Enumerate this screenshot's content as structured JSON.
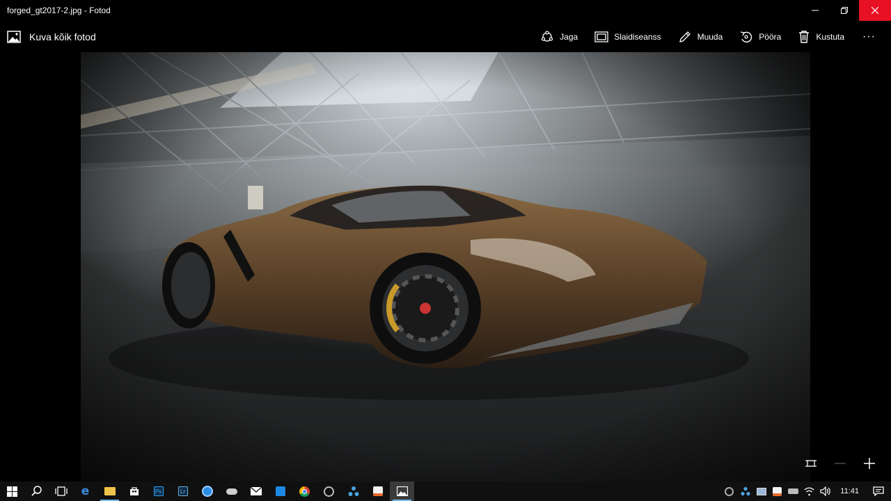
{
  "window": {
    "title": "forged_gt2017-2.jpg - Fotod"
  },
  "appbar": {
    "back_label": "Kuva kõik fotod",
    "commands": [
      {
        "label": "Jaga",
        "icon": "share-icon"
      },
      {
        "label": "Slaidiseanss",
        "icon": "slideshow-icon"
      },
      {
        "label": "Muuda",
        "icon": "pencil-icon"
      },
      {
        "label": "Pööra",
        "icon": "rotate-icon"
      },
      {
        "label": "Kustuta",
        "icon": "trash-icon"
      }
    ],
    "more": "···"
  },
  "taskbar": {
    "clock": "11:41"
  },
  "colors": {
    "close_red": "#e81123",
    "accent": "#76b9ed"
  }
}
